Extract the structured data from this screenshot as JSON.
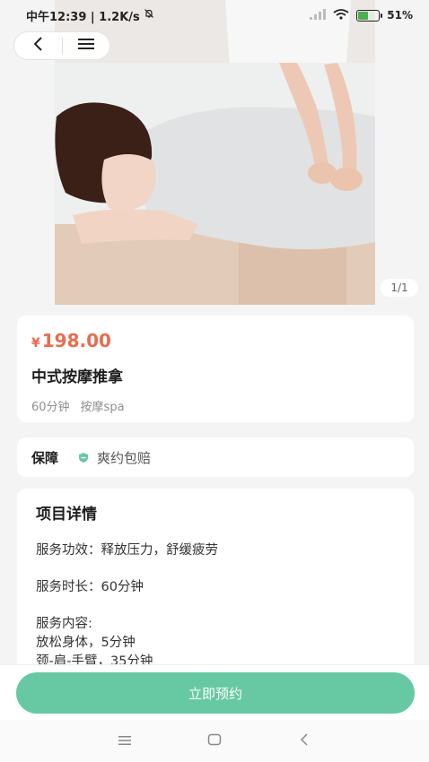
{
  "status_bar": {
    "time_speed": "中午12:39 | 1.2K/s",
    "battery_percent": "51%",
    "battery_level": 0.51
  },
  "nav": {
    "back_icon": "chevron-left-icon",
    "menu_icon": "menu-icon"
  },
  "gallery": {
    "counter": "1/1"
  },
  "product": {
    "currency": "¥",
    "price": "198.00",
    "title": "中式按摩推拿",
    "duration": "60分钟",
    "category": "按摩spa"
  },
  "guarantee": {
    "label": "保障",
    "icon": "shield-icon",
    "text": "爽约包赔"
  },
  "details": {
    "title": "项目详情",
    "effect": "服务功效：释放压力，舒缓疲劳",
    "duration": "服务时长：60分钟",
    "content_label": "服务内容:",
    "content_items": [
      "放松身体，5分钟",
      "颈-肩-手臂，35分钟"
    ]
  },
  "actions": {
    "book_label": "立即预约",
    "accent_color": "#67c9a3",
    "price_color": "#e86c4e"
  },
  "system_nav": {
    "icons": [
      "recents-icon",
      "home-icon",
      "back-icon"
    ]
  }
}
